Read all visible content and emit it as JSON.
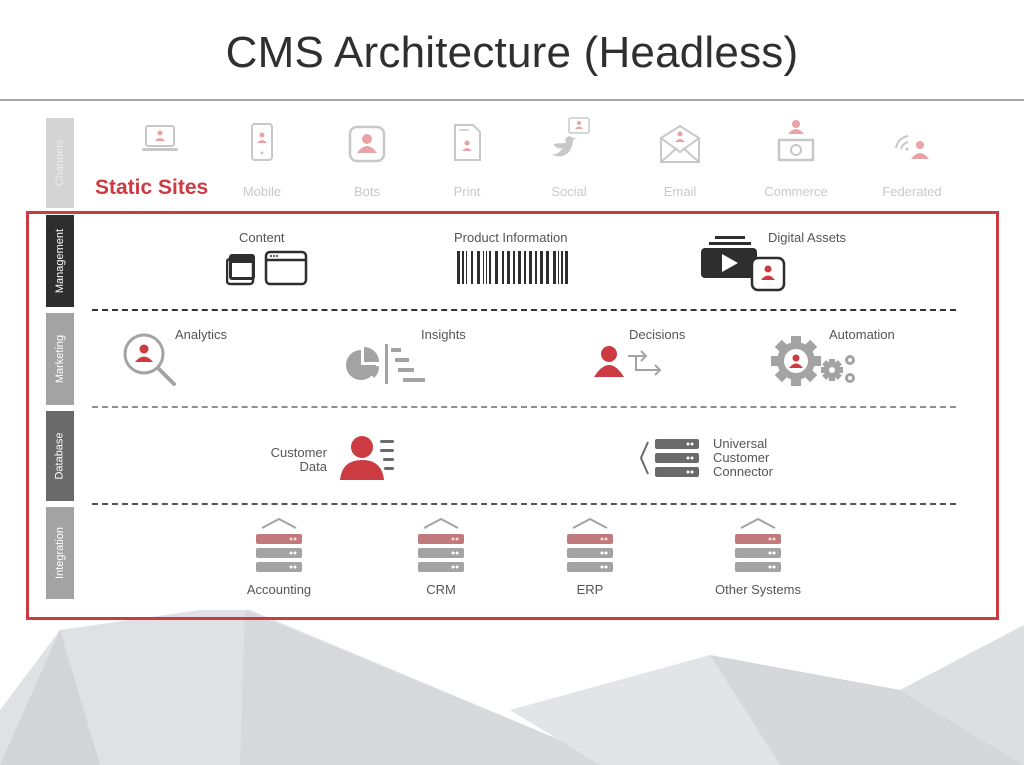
{
  "title": "CMS Architecture (Headless)",
  "colors": {
    "accent_red": "#cc3b41",
    "dark": "#2e2e2e",
    "gray": "#a3a3a3",
    "mid_gray": "#6a6a6a",
    "faded_red": "#e8a3a6"
  },
  "layers": {
    "channels": "Channels",
    "management": "Management",
    "marketing": "Marketing",
    "database": "Database",
    "integration": "Integration"
  },
  "channels": {
    "highlighted": "Static Sites",
    "items": [
      {
        "label": "Mobile",
        "icon": "mobile-phone-icon"
      },
      {
        "label": "Bots",
        "icon": "bot-icon"
      },
      {
        "label": "Print",
        "icon": "print-document-icon"
      },
      {
        "label": "Social",
        "icon": "twitter-bird-icon"
      },
      {
        "label": "Email",
        "icon": "envelope-icon"
      },
      {
        "label": "Commerce",
        "icon": "money-bill-icon"
      },
      {
        "label": "Federated",
        "icon": "wireless-user-icon"
      }
    ]
  },
  "management": {
    "content": "Content",
    "product_information": "Product Information",
    "digital_assets": "Digital Assets"
  },
  "marketing": {
    "analytics": "Analytics",
    "insights": "Insights",
    "decisions": "Decisions",
    "automation": "Automation"
  },
  "database": {
    "customer_data_line1": "Customer",
    "customer_data_line2": "Data",
    "ucc_line1": "Universal",
    "ucc_line2": "Customer",
    "ucc_line3": "Connector"
  },
  "integration": {
    "items": [
      "Accounting",
      "CRM",
      "ERP",
      "Other Systems"
    ]
  }
}
